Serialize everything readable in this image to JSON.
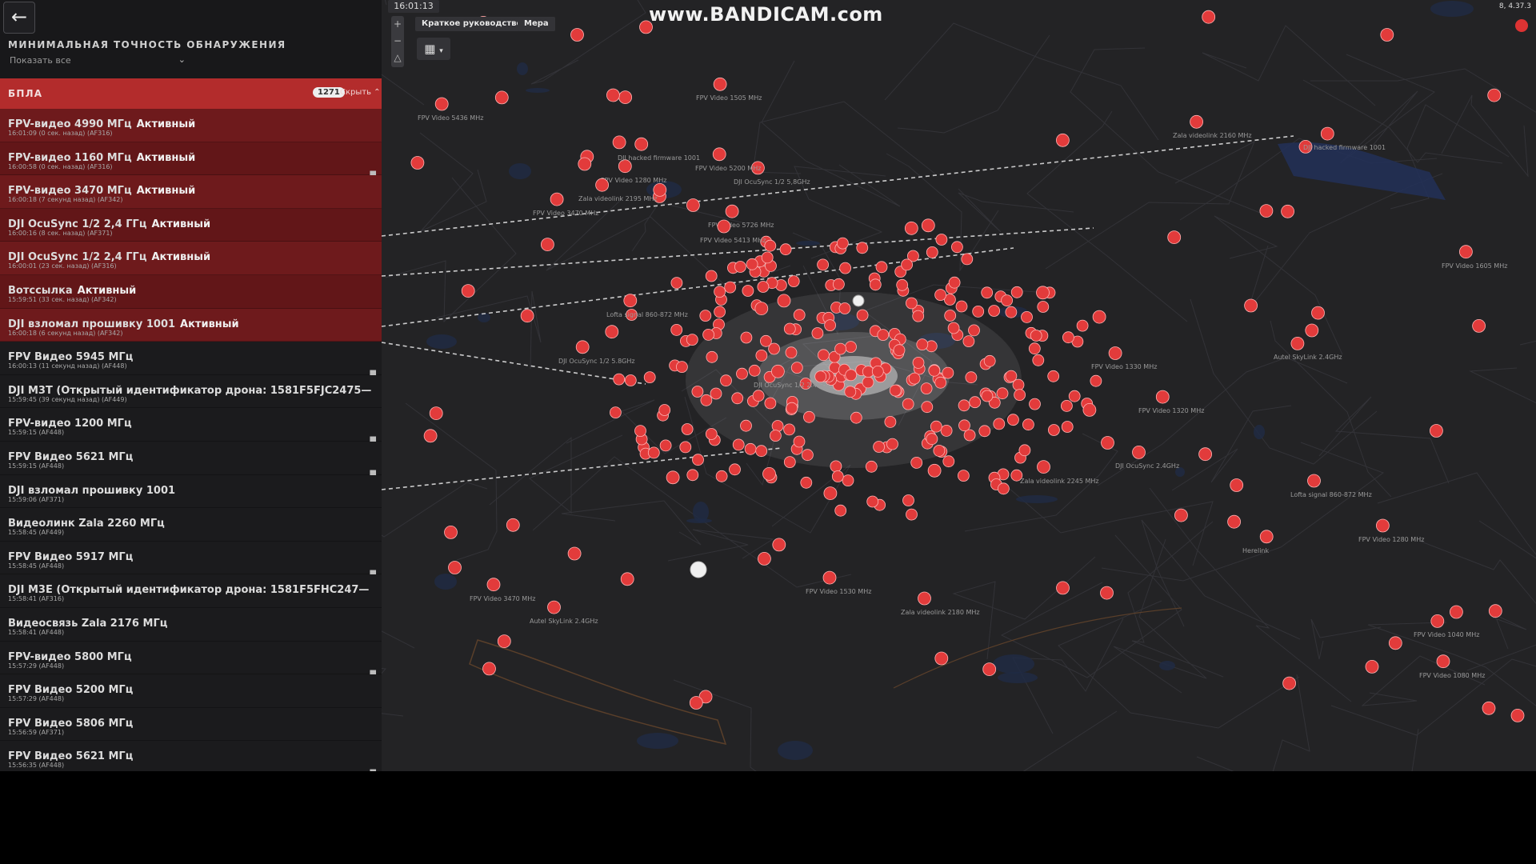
{
  "filter": {
    "title": "МИНИМАЛЬНАЯ ТОЧНОСТЬ ОБНАРУЖЕНИЯ",
    "value": "Показать все"
  },
  "uav_panel": {
    "title": "БПЛА",
    "count": "1271",
    "hide_label": "Скрыть"
  },
  "detections": [
    {
      "name": "FPV-видео 4990 МГц",
      "status": "Активный",
      "sub": "16:01:09 (0 сек. назад) (AF316)",
      "active": true,
      "camera": false
    },
    {
      "name": "FPV-видео 1160 МГц",
      "status": "Активный",
      "sub": "16:00:58 (0 сек. назад) (AF316)",
      "active": true,
      "camera": true
    },
    {
      "name": "FPV-видео 3470 МГц",
      "status": "Активный",
      "sub": "16:00:18 (7 секунд назад) (AF342)",
      "active": true,
      "camera": false
    },
    {
      "name": "DJI OcuSync 1/2 2,4 ГГц",
      "status": "Активный",
      "sub": "16:00:16 (8 сек. назад) (AF371)",
      "active": true,
      "camera": false
    },
    {
      "name": "DJI OcuSync 1/2 2,4 ГГц",
      "status": "Активный",
      "sub": "16:00:01 (23 сек. назад) (AF316)",
      "active": true,
      "camera": false
    },
    {
      "name": "Вотсcылка",
      "status": "Активный",
      "sub": "15:59:51 (33 сек. назад) (AF342)",
      "active": true,
      "camera": false
    },
    {
      "name": "DJI взломал прошивку 1001",
      "status": "Активный",
      "sub": "16:00:18 (6 секунд назад) (AF342)",
      "active": true,
      "camera": false
    },
    {
      "name": "FPV Видео 5945 МГц",
      "status": "",
      "sub": "16:00:13 (11 секунд назад) (AF448)",
      "active": false,
      "camera": true
    },
    {
      "name": "DJI M3T (Открытый идентификатор дрона: 1581F5FJC2475—",
      "status": "",
      "sub": "15:59:45 (39 секунд назад) (AF449)",
      "active": false,
      "camera": false
    },
    {
      "name": "FPV-видео 1200 МГц",
      "status": "",
      "sub": "15:59:15 (AF448)",
      "active": false,
      "camera": true
    },
    {
      "name": "FPV Видео 5621 МГц",
      "status": "",
      "sub": "15:59:15 (AF448)",
      "active": false,
      "camera": true
    },
    {
      "name": "DJI взломал прошивку 1001",
      "status": "",
      "sub": "15:59:06 (AF371)",
      "active": false,
      "camera": false
    },
    {
      "name": "Видеолинк Zala 2260 МГц",
      "status": "",
      "sub": "15:58:45 (AF449)",
      "active": false,
      "camera": false
    },
    {
      "name": "FPV Видео 5917 МГц",
      "status": "",
      "sub": "15:58:45 (AF448)",
      "active": false,
      "camera": true
    },
    {
      "name": "DJI M3E (Открытый идентификатор дрона: 1581F5FHC247—",
      "status": "",
      "sub": "15:58:41 (AF316)",
      "active": false,
      "camera": false
    },
    {
      "name": "Видеосвязь Zala 2176 МГц",
      "status": "",
      "sub": "15:58:41 (AF448)",
      "active": false,
      "camera": false
    },
    {
      "name": "FPV-видео 5800 МГц",
      "status": "",
      "sub": "15:57:29 (AF448)",
      "active": false,
      "camera": true
    },
    {
      "name": "FPV Видео 5200 МГц",
      "status": "",
      "sub": "15:57:29 (AF448)",
      "active": false,
      "camera": false
    },
    {
      "name": "FPV Видео 5806 МГц",
      "status": "",
      "sub": "15:56:59 (AF371)",
      "active": false,
      "camera": false
    },
    {
      "name": "FPV Видео 5621 МГц",
      "status": "",
      "sub": "15:56:35 (AF448)",
      "active": false,
      "camera": true
    }
  ],
  "map": {
    "clock": "16:01:13",
    "button_guide": "Краткое руководство",
    "button_measure": "Мера",
    "watermark": "www.BANDICAM.com",
    "top_right": "8, 4.37.3",
    "zoom_in": "+",
    "zoom_out": "−",
    "marker_color": "#e23b3b",
    "accent": "#b32c2c",
    "labels": [
      "FPV Video 1280 MHz",
      "FPV Video 1530 MHz",
      "Lofta signal 860-872 MHz",
      "FPV Video 1320 MHz",
      "FPV Video 3470 MHz",
      "FPV Video 5726 MHz",
      "DJI OcuSync 1/2 5,8GHz",
      "Zala videolink 2245 MHz",
      "Herelink",
      "FPV Video 5436 MHz",
      "Zala videolink 2195 MHz",
      "FPV Video 1280 MHz",
      "Autel SkyLink 2.4GHz",
      "FPV Video 1080 MHz",
      "Lofta signal 860-872 MHz",
      "DJI OcuSync 2.4GHz",
      "Autel SkyLink 2.4GHz",
      "DJI hacked firmware 1001",
      "FPV Video 5413 MHz",
      "DJI OcuSync 1/2 2.4GHz",
      "FPV Video 1505 MHz",
      "FPV Video 5200 MHz",
      "Zala videolink 2160 MHz",
      "Zala videolink 2180 MHz",
      "DJI hacked firmware 1001",
      "FPV Video 1040 MHz",
      "FPV Video 1605 MHz",
      "DJI OcuSync 1/2 5.8GHz",
      "FPV Video 3470 MHz",
      "FPV Video 1330 MHz"
    ]
  }
}
